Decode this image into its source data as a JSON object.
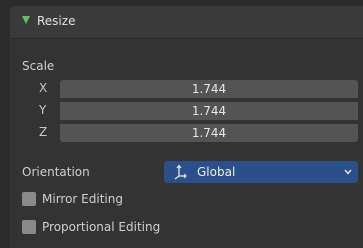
{
  "panel": {
    "title": "Resize",
    "scale_label": "Scale",
    "scale": [
      {
        "axis": "X",
        "value": "1.744"
      },
      {
        "axis": "Y",
        "value": "1.744"
      },
      {
        "axis": "Z",
        "value": "1.744"
      }
    ],
    "orientation_label": "Orientation",
    "orientation_value": "Global",
    "mirror_editing_label": "Mirror Editing",
    "mirror_editing_checked": false,
    "proportional_editing_label": "Proportional Editing",
    "proportional_editing_checked": false
  },
  "colors": {
    "header_triangle": "#5ec35e",
    "dropdown_bg": "#2a4f8a",
    "field_bg": "#545454"
  }
}
